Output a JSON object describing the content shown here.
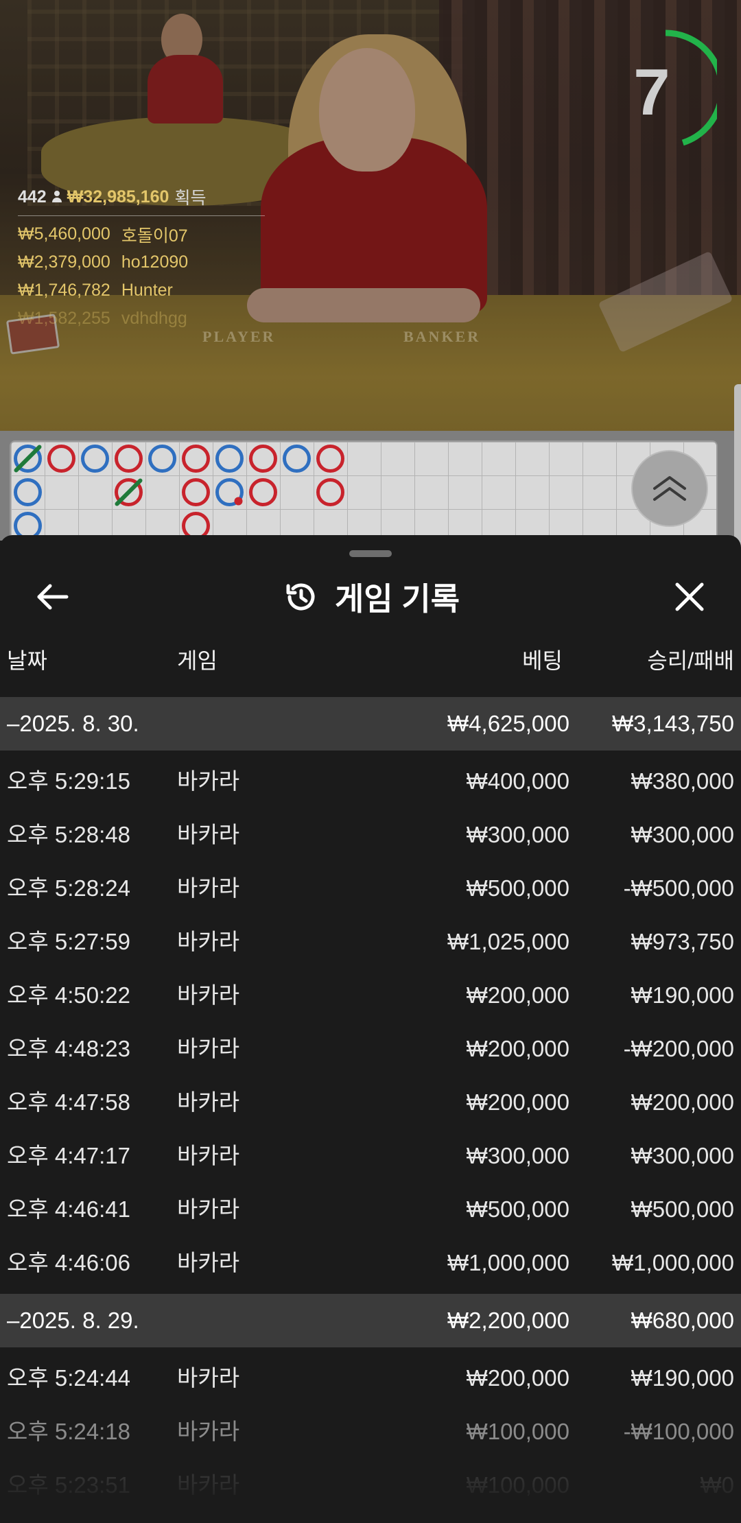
{
  "timer": {
    "seconds": "7",
    "fraction_remaining": 0.45
  },
  "winners": {
    "player_count": "442",
    "total_amount": "₩32,985,160",
    "total_label": "획득",
    "entries": [
      {
        "amount": "₩5,460,000",
        "name": "호돌이07"
      },
      {
        "amount": "₩2,379,000",
        "name": "ho12090"
      },
      {
        "amount": "₩1,746,782",
        "name": "Hunter"
      },
      {
        "amount": "₩1,582,255",
        "name": "vdhdhgg"
      }
    ]
  },
  "table_labels": {
    "player": "PLAYER",
    "banker": "BANKER"
  },
  "bead_road": {
    "colors": {
      "banker": "#c8232c",
      "player": "#2f6fc0",
      "tie": "#1f7a3a"
    },
    "columns": [
      [
        "P-tie",
        "P",
        "P"
      ],
      [
        "B"
      ],
      [
        "P"
      ],
      [
        "B",
        "B-tie"
      ],
      [
        "P"
      ],
      [
        "B",
        "B",
        "B"
      ],
      [
        "P",
        "P-pair"
      ],
      [
        "B",
        "B"
      ],
      [
        "P"
      ],
      [
        "B",
        "B"
      ]
    ]
  },
  "panel": {
    "title": "게임 기록",
    "icons": {
      "back": "arrow-left-icon",
      "title": "history-icon",
      "close": "close-icon",
      "scroll": "chevron-double-up-icon"
    },
    "columns": {
      "date": "날짜",
      "game": "게임",
      "bet": "베팅",
      "result": "승리/패배"
    },
    "groups": [
      {
        "date": "–2025. 8. 30.",
        "bet_total": "₩4,625,000",
        "result_total": "₩3,143,750",
        "rows": [
          {
            "time": "오후 5:29:15",
            "game": "바카라",
            "bet": "₩400,000",
            "result": "₩380,000"
          },
          {
            "time": "오후 5:28:48",
            "game": "바카라",
            "bet": "₩300,000",
            "result": "₩300,000"
          },
          {
            "time": "오후 5:28:24",
            "game": "바카라",
            "bet": "₩500,000",
            "result": "-₩500,000"
          },
          {
            "time": "오후 5:27:59",
            "game": "바카라",
            "bet": "₩1,025,000",
            "result": "₩973,750"
          },
          {
            "time": "오후 4:50:22",
            "game": "바카라",
            "bet": "₩200,000",
            "result": "₩190,000"
          },
          {
            "time": "오후 4:48:23",
            "game": "바카라",
            "bet": "₩200,000",
            "result": "-₩200,000"
          },
          {
            "time": "오후 4:47:58",
            "game": "바카라",
            "bet": "₩200,000",
            "result": "₩200,000"
          },
          {
            "time": "오후 4:47:17",
            "game": "바카라",
            "bet": "₩300,000",
            "result": "₩300,000"
          },
          {
            "time": "오후 4:46:41",
            "game": "바카라",
            "bet": "₩500,000",
            "result": "₩500,000"
          },
          {
            "time": "오후 4:46:06",
            "game": "바카라",
            "bet": "₩1,000,000",
            "result": "₩1,000,000"
          }
        ]
      },
      {
        "date": "–2025. 8. 29.",
        "bet_total": "₩2,200,000",
        "result_total": "₩680,000",
        "rows": [
          {
            "time": "오후 5:24:44",
            "game": "바카라",
            "bet": "₩200,000",
            "result": "₩190,000"
          },
          {
            "time": "오후 5:24:18",
            "game": "바카라",
            "bet": "₩100,000",
            "result": "-₩100,000"
          },
          {
            "time": "오후 5:23:51",
            "game": "바카라",
            "bet": "₩100,000",
            "result": "₩0"
          }
        ]
      }
    ]
  }
}
